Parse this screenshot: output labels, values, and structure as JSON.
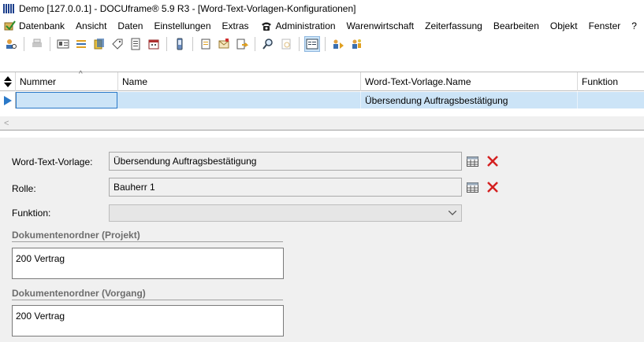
{
  "window": {
    "title": "Demo [127.0.0.1] - DOCUframe® 5.9 R3 - [Word-Text-Vorlagen-Konfigurationen]"
  },
  "menu": {
    "items": [
      "Datenbank",
      "Ansicht",
      "Daten",
      "Einstellungen",
      "Extras",
      "Administration",
      "Warenwirtschaft",
      "Zeiterfassung",
      "Bearbeiten",
      "Objekt",
      "Fenster",
      "?"
    ]
  },
  "grid": {
    "columns": [
      "Nummer",
      "Name",
      "Word-Text-Vorlage.Name",
      "Funktion"
    ],
    "rows": [
      {
        "nummer": "",
        "name": "",
        "vorlage": "Übersendung Auftragsbestätigung",
        "funktion": ""
      }
    ],
    "scroll_left_glyph": "<"
  },
  "form": {
    "vorlage_label": "Word-Text-Vorlage:",
    "vorlage_value": "Übersendung Auftragsbestätigung",
    "rolle_label": "Rolle:",
    "rolle_value": "Bauherr 1",
    "funktion_label": "Funktion:",
    "funktion_value": "",
    "projekt_group": "Dokumentenordner (Projekt)",
    "projekt_value": "200 Vertrag",
    "vorgang_group": "Dokumentenordner (Vorgang)",
    "vorgang_value": "200 Vertrag"
  },
  "colors": {
    "selection": "#cce4f7",
    "delete_red": "#d42020",
    "accent_blue": "#2b79c8"
  }
}
